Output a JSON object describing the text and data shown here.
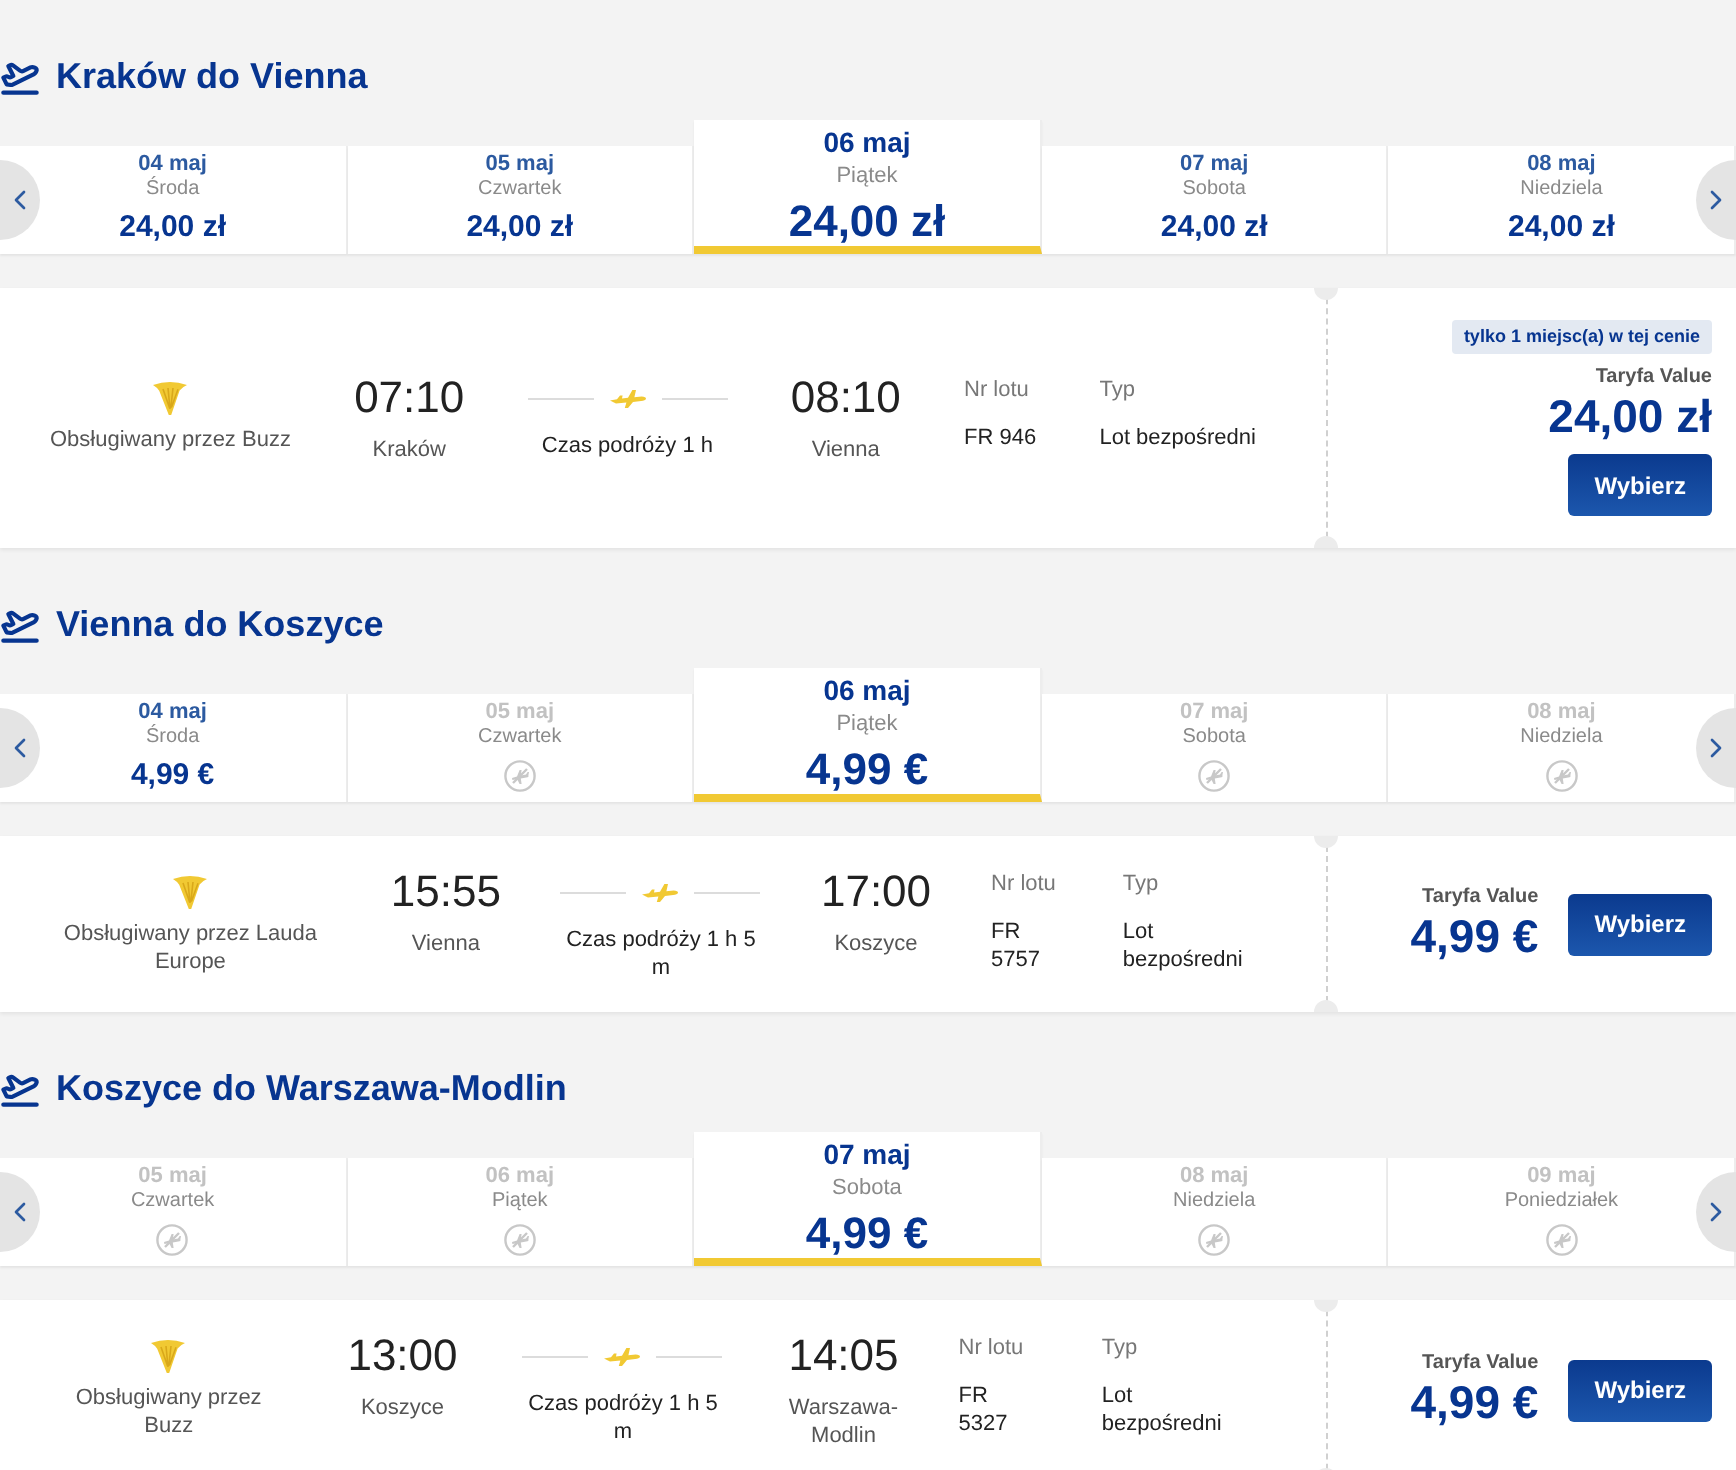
{
  "sections": [
    {
      "title": "Kraków do Vienna",
      "dates": [
        {
          "date": "04 maj",
          "weekday": "Środa",
          "price": "24,00 zł",
          "available": true,
          "selected": false
        },
        {
          "date": "05 maj",
          "weekday": "Czwartek",
          "price": "24,00 zł",
          "available": true,
          "selected": false
        },
        {
          "date": "06 maj",
          "weekday": "Piątek",
          "price": "24,00 zł",
          "available": true,
          "selected": true
        },
        {
          "date": "07 maj",
          "weekday": "Sobota",
          "price": "24,00 zł",
          "available": true,
          "selected": false
        },
        {
          "date": "08 maj",
          "weekday": "Niedziela",
          "price": "24,00 zł",
          "available": true,
          "selected": false
        }
      ],
      "flight": {
        "operator": "Obsługiwany przez Buzz",
        "departure": {
          "time": "07:10",
          "city": "Kraków"
        },
        "duration": "Czas podróży 1 h",
        "arrival": {
          "time": "08:10",
          "city": "Vienna"
        },
        "flight_number_label": "Nr lotu",
        "flight_number": "FR 946",
        "type_label": "Typ",
        "type": "Lot bezpośredni",
        "badge": "tylko 1 miejsc(a) w tej cenie",
        "fare_label": "Taryfa Value",
        "price": "24,00 zł",
        "button": "Wybierz"
      }
    },
    {
      "title": "Vienna do Koszyce",
      "dates": [
        {
          "date": "04 maj",
          "weekday": "Środa",
          "price": "4,99 €",
          "available": true,
          "selected": false
        },
        {
          "date": "05 maj",
          "weekday": "Czwartek",
          "available": false,
          "selected": false
        },
        {
          "date": "06 maj",
          "weekday": "Piątek",
          "price": "4,99 €",
          "available": true,
          "selected": true
        },
        {
          "date": "07 maj",
          "weekday": "Sobota",
          "available": false,
          "selected": false
        },
        {
          "date": "08 maj",
          "weekday": "Niedziela",
          "available": false,
          "selected": false
        }
      ],
      "flight": {
        "operator": "Obsługiwany przez Lauda Europe",
        "departure": {
          "time": "15:55",
          "city": "Vienna"
        },
        "duration": "Czas podróży 1 h 5 m",
        "arrival": {
          "time": "17:00",
          "city": "Koszyce"
        },
        "flight_number_label": "Nr lotu",
        "flight_number": "FR 5757",
        "type_label": "Typ",
        "type": "Lot bezpośredni",
        "fare_label": "Taryfa Value",
        "price": "4,99 €",
        "button": "Wybierz"
      }
    },
    {
      "title": "Koszyce do Warszawa-Modlin",
      "dates": [
        {
          "date": "05 maj",
          "weekday": "Czwartek",
          "available": false,
          "selected": false
        },
        {
          "date": "06 maj",
          "weekday": "Piątek",
          "available": false,
          "selected": false
        },
        {
          "date": "07 maj",
          "weekday": "Sobota",
          "price": "4,99 €",
          "available": true,
          "selected": true
        },
        {
          "date": "08 maj",
          "weekday": "Niedziela",
          "available": false,
          "selected": false
        },
        {
          "date": "09 maj",
          "weekday": "Poniedziałek",
          "available": false,
          "selected": false
        }
      ],
      "flight": {
        "operator": "Obsługiwany przez Buzz",
        "departure": {
          "time": "13:00",
          "city": "Koszyce"
        },
        "duration": "Czas podróży 1 h 5 m",
        "arrival": {
          "time": "14:05",
          "city": "Warszawa-Modlin"
        },
        "flight_number_label": "Nr lotu",
        "flight_number": "FR 5327",
        "type_label": "Typ",
        "type": "Lot bezpośredni",
        "fare_label": "Taryfa Value",
        "price": "4,99 €",
        "button": "Wybierz"
      }
    }
  ]
}
